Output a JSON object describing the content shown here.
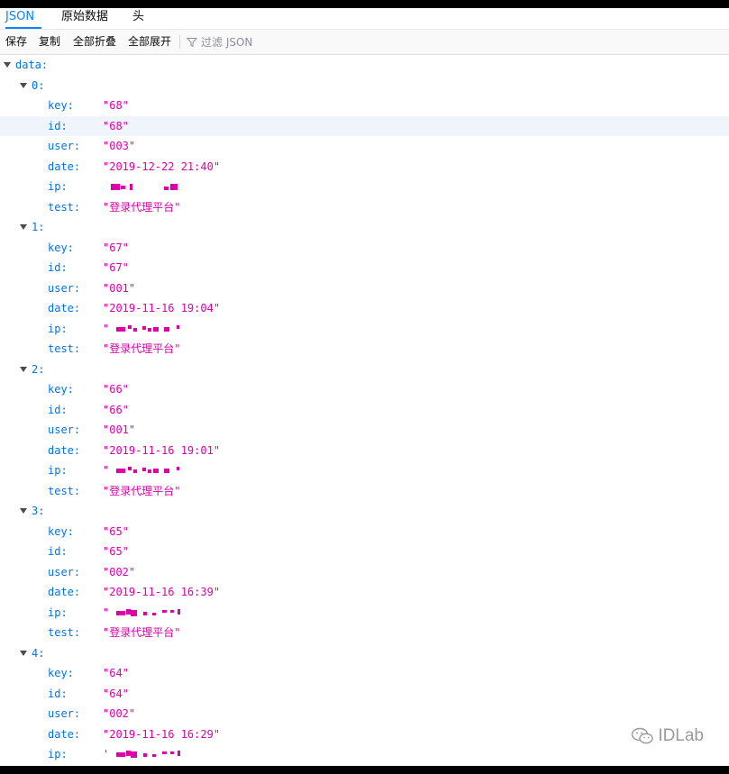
{
  "tabs": [
    {
      "label": "JSON",
      "active": true
    },
    {
      "label": "原始数据",
      "active": false
    },
    {
      "label": "头",
      "active": false
    }
  ],
  "toolbar": {
    "save_label": "保存",
    "copy_label": "复制",
    "collapse_all_label": "全部折叠",
    "expand_all_label": "全部展开",
    "filter_placeholder": "过滤 JSON",
    "filter_icon": "funnel-icon"
  },
  "tree": {
    "root_key": "data:",
    "records": [
      {
        "index": "0:",
        "fields": [
          {
            "key": "key:",
            "value": "\"68\""
          },
          {
            "key": "id:",
            "value": "\"68\""
          },
          {
            "key": "user:",
            "value": "\"003\""
          },
          {
            "key": "date:",
            "value": "\"2019-12-22 21:40\""
          },
          {
            "key": "ip:",
            "value": ""
          },
          {
            "key": "test:",
            "value": "\"登录代理平台\""
          }
        ]
      },
      {
        "index": "1:",
        "fields": [
          {
            "key": "key:",
            "value": "\"67\""
          },
          {
            "key": "id:",
            "value": "\"67\""
          },
          {
            "key": "user:",
            "value": "\"001\""
          },
          {
            "key": "date:",
            "value": "\"2019-11-16 19:04\""
          },
          {
            "key": "ip:",
            "value": "\""
          },
          {
            "key": "test:",
            "value": "\"登录代理平台\""
          }
        ]
      },
      {
        "index": "2:",
        "fields": [
          {
            "key": "key:",
            "value": "\"66\""
          },
          {
            "key": "id:",
            "value": "\"66\""
          },
          {
            "key": "user:",
            "value": "\"001\""
          },
          {
            "key": "date:",
            "value": "\"2019-11-16 19:01\""
          },
          {
            "key": "ip:",
            "value": "\""
          },
          {
            "key": "test:",
            "value": "\"登录代理平台\""
          }
        ]
      },
      {
        "index": "3:",
        "fields": [
          {
            "key": "key:",
            "value": "\"65\""
          },
          {
            "key": "id:",
            "value": "\"65\""
          },
          {
            "key": "user:",
            "value": "\"002\""
          },
          {
            "key": "date:",
            "value": "\"2019-11-16 16:39\""
          },
          {
            "key": "ip:",
            "value": "\""
          },
          {
            "key": "test:",
            "value": "\"登录代理平台\""
          }
        ]
      },
      {
        "index": "4:",
        "fields": [
          {
            "key": "key:",
            "value": "\"64\""
          },
          {
            "key": "id:",
            "value": "\"64\""
          },
          {
            "key": "user:",
            "value": "\"002\""
          },
          {
            "key": "date:",
            "value": "\"2019-11-16 16:29\""
          },
          {
            "key": "ip:",
            "value": "'"
          }
        ]
      }
    ]
  },
  "watermark": {
    "text": "IDLab",
    "icon": "wechat-icon"
  },
  "colors": {
    "key": "#0074e8",
    "string": "#dd00a9",
    "active_tab": "#0a84ff"
  }
}
